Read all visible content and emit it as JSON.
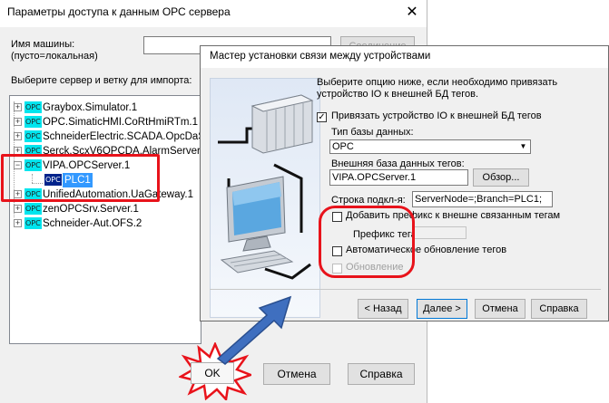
{
  "back_dialog": {
    "title": "Параметры доступа к данным ОРС сервера",
    "close_glyph": "✕",
    "machine_name_label_line1": "Имя машины:",
    "machine_name_label_line2": "(пусто=локальная)",
    "machine_name_value": "",
    "connect_button": "Соединение",
    "select_label": "Выберите сервер и ветку для импорта:",
    "tree": [
      {
        "expander": "+",
        "icon": "OPC",
        "label": "Graybox.Simulator.1"
      },
      {
        "expander": "+",
        "icon": "OPC",
        "label": "OPC.SimaticHMI.CoRtHmiRTm.1"
      },
      {
        "expander": "+",
        "icon": "OPC",
        "label": "SchneiderElectric.SCADA.OpcDaSe"
      },
      {
        "expander": "+",
        "icon": "OPC",
        "label": "Serck.ScxV6OPCDA.AlarmServer1."
      },
      {
        "expander": "−",
        "icon": "OPC",
        "label": "VIPA.OPCServer.1"
      },
      {
        "expander": "",
        "icon": "OPC",
        "label": "PLC1",
        "selected": true
      },
      {
        "expander": "+",
        "icon": "OPC",
        "label": "UnifiedAutomation.UaGateway.1"
      },
      {
        "expander": "+",
        "icon": "OPC",
        "label": "zenOPCSrv.Server.1"
      },
      {
        "expander": "+",
        "icon": "OPC",
        "label": "Schneider-Aut.OFS.2"
      }
    ],
    "ok_button": "OK",
    "cancel_button": "Отмена",
    "help_button": "Справка"
  },
  "wizard": {
    "title": "Мастер установки связи между устройствами",
    "description": "Выберите опцию ниже, если необходимо привязать устройство IO к внешней БД тегов.",
    "bind_checkbox_label": "Привязать устройство IO к внешней БД тегов",
    "bind_checked": true,
    "db_type_label": "Тип базы данных:",
    "db_type_value": "OPC",
    "external_db_label": "Внешняя база данных тегов:",
    "external_db_value": "VIPA.OPCServer.1",
    "browse_button": "Обзор...",
    "connection_string_label": "Строка подкл-я:",
    "connection_string_value": "ServerNode=;Branch=PLC1;",
    "prefix_checkbox_label": "Добавить префикс к внешне связанным тегам",
    "prefix_checked": false,
    "prefix_label": "Префикс тега:",
    "prefix_value": "",
    "auto_update_label": "Автоматическое обновление тегов",
    "auto_update_checked": false,
    "update_label": "Обновление",
    "update_checked": false,
    "back_button": "< Назад",
    "next_button": "Далее >",
    "cancel_button": "Отмена",
    "help_button": "Справка"
  },
  "colors": {
    "highlight_red": "#e8131b",
    "arrow_blue": "#3f6fbf",
    "opc_icon": "#00e5ee",
    "selection": "#3399ff"
  }
}
